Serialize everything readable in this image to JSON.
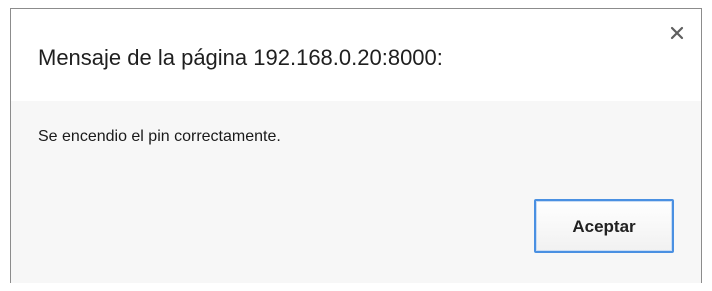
{
  "dialog": {
    "title": "Mensaje de la página 192.168.0.20:8000:",
    "message": "Se encendio el pin correctamente.",
    "close_icon": "close-icon",
    "ok_label": "Aceptar"
  },
  "colors": {
    "border": "#8c8c8c",
    "band_background": "#f7f7f7",
    "focus_ring": "#4a90e2"
  }
}
